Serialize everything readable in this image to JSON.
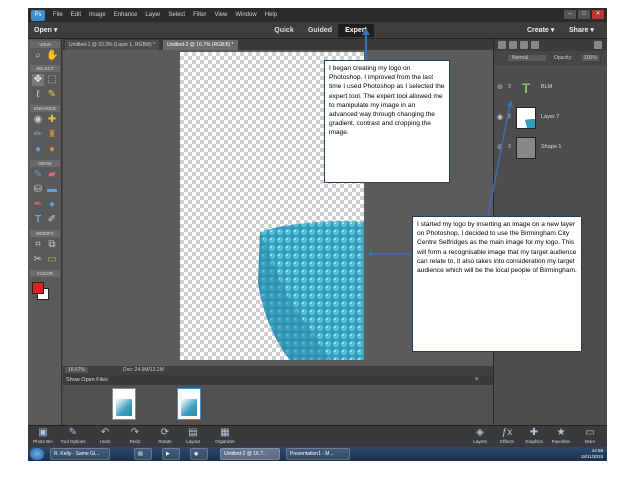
{
  "menu": {
    "items": [
      "File",
      "Edit",
      "Image",
      "Enhance",
      "Layer",
      "Select",
      "Filter",
      "View",
      "Window",
      "Help"
    ]
  },
  "modebar": {
    "open": "Open ▾",
    "modes": [
      "Quick",
      "Guided",
      "Expert"
    ],
    "active_mode": "Expert",
    "create": "Create ▾",
    "share": "Share ▾"
  },
  "toolbox": {
    "sections": [
      "VIEW",
      "SELECT",
      "ENHANCE",
      "DRAW",
      "MODIFY",
      "COLOR"
    ],
    "foreground_color": "#e02020",
    "background_color": "#ffffff"
  },
  "document": {
    "tabs": [
      "Untitled-1 @ 33.3% (Layer 1, RGB/8) *",
      "Untitled-2 @ 16.7% (RGB/8) *"
    ],
    "zoom": "16.67%",
    "doc_info": "Doc: 24.9M/13.2M"
  },
  "photo_bin": {
    "selector": "Show Open Files"
  },
  "layers": {
    "blend_mode": "Normal",
    "opacity_label": "Opacity:",
    "opacity": "100%",
    "items": [
      {
        "name": "BLM"
      },
      {
        "name": "Layer 7"
      },
      {
        "name": "Shape 1"
      }
    ]
  },
  "bottombar": {
    "left": [
      "Photo Bin",
      "Tool Options",
      "Undo",
      "Redo",
      "Rotate",
      "Layout",
      "Organizer"
    ],
    "right": [
      "Layers",
      "Effects",
      "Graphics",
      "Favorites",
      "More"
    ]
  },
  "taskbar": {
    "items": [
      "R. Kelly - Same Gi...",
      "Untitled-2 @ 16.7...",
      "Presentation1 - M..."
    ],
    "time": "14:58",
    "date": "18/11/2015"
  },
  "callouts": {
    "first": "I began creating my logo on Photoshop. I improved from the last time I used Photoshop as I selected the expert tool. The expert tool allowed me to manipulate my image in an advanced way through changing the gradient, contrast and cropping the image.",
    "second": "I started my logo by inserting an image on a new layer on Photoshop. I decided to use the Birmingham City Centre Selfridges as the main image for my logo. This will form a recognisable image that my target audience can relate to, it also takes into consideration my target audience which will be the local people of Birmingham."
  },
  "colors": {
    "accent": "#3b8ed1",
    "logo_teal": "#2e9cc0",
    "callout_border": "#233f6b"
  }
}
